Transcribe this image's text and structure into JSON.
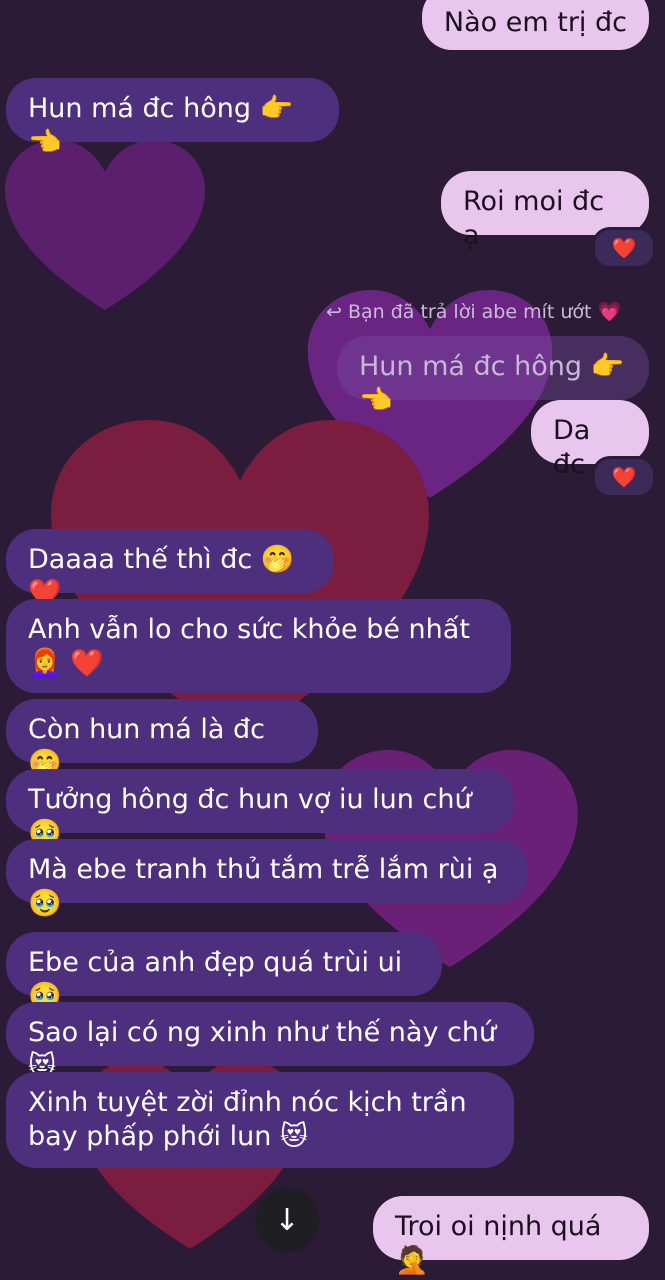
{
  "messages": [
    {
      "id": "m1",
      "side": "out",
      "text": "Nào em trị đc"
    },
    {
      "id": "m2",
      "side": "in",
      "text": "Hun má đc hông 👉👈"
    },
    {
      "id": "m3",
      "side": "out",
      "text": "Roi moi đc ạ",
      "reaction": "❤️"
    },
    {
      "id": "m4",
      "side": "out",
      "text": "Da đc",
      "reaction": "❤️"
    },
    {
      "id": "m5",
      "side": "in",
      "text": "Daaaa thế thì đc 🤭❤️"
    },
    {
      "id": "m6",
      "side": "in",
      "text": "Anh vẫn lo cho sức khỏe bé nhất 👩‍🦰 ❤️"
    },
    {
      "id": "m7",
      "side": "in",
      "text": "Còn hun má là đc 🤭"
    },
    {
      "id": "m8",
      "side": "in",
      "text": "Tưởng hông đc hun vợ iu lun chứ 🥹"
    },
    {
      "id": "m9",
      "side": "in",
      "text": "Mà ebe tranh thủ tắm trễ lắm rùi ạ 🥹"
    },
    {
      "id": "m10",
      "side": "in",
      "text": "Ebe của anh đẹp quá trùi ui 🥹"
    },
    {
      "id": "m11",
      "side": "in",
      "text": "Sao lại có ng xinh như thế này chứ 😻"
    },
    {
      "id": "m12",
      "side": "in",
      "text": "Xinh tuyệt zời đỉnh nóc kịch trần bay phấp phới lun 😻"
    },
    {
      "id": "m13",
      "side": "out",
      "text": "Troi oi nịnh quá 🤦"
    }
  ],
  "reply": {
    "note": "Bạn đã trả lời abe mít ướt 💗",
    "quoted_text": "Hun má đc hông 👉👈"
  },
  "scroll_down_icon": "arrow-down-icon",
  "colors": {
    "background": "#2b1b36",
    "incoming_bubble": "#4d2f7d",
    "outgoing_bubble": "#e8c6ee",
    "reaction_heart": "#e0304a"
  }
}
